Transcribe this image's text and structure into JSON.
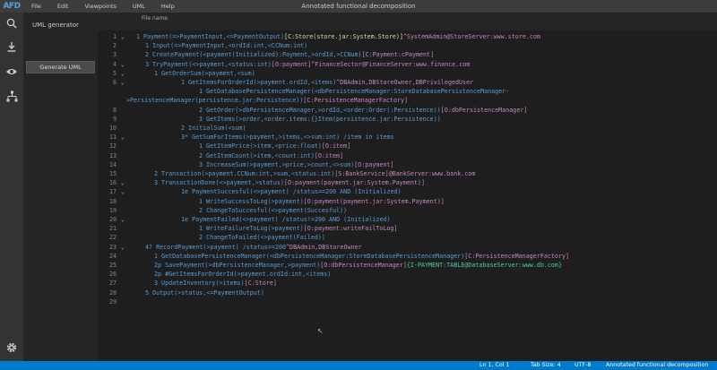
{
  "app": {
    "logo": "AFD",
    "window_title": "Annotated functional decomposition"
  },
  "menu": [
    "File",
    "Edit",
    "Viewpoints",
    "UML",
    "Help"
  ],
  "sidebar": {
    "title": "UML generator",
    "generate_button": "Generate UML"
  },
  "editor": {
    "tab_label": "File name"
  },
  "icons": [
    "search-icon",
    "download-icon",
    "eye-icon",
    "hierarchy-icon",
    "gear-icon"
  ],
  "code": [
    {
      "n": "1",
      "fold": "v",
      "ind": 0,
      "segs": [
        [
          "1 Payment(=>PaymentInput,<=PaymentOutput)",
          "k"
        ],
        [
          "[C:Store(store.jar:System.Store)]",
          "y"
        ],
        [
          "^SystemAdmin@StoreServer:www.store.com",
          "n"
        ]
      ]
    },
    {
      "n": "2",
      "fold": "",
      "ind": 1,
      "segs": [
        [
          "1 Input(=>PaymentInput,<ordId:int,<CCNum:int)",
          "k"
        ]
      ]
    },
    {
      "n": "3",
      "fold": "",
      "ind": 1,
      "segs": [
        [
          "2 CreatePayment(<payment(Initialized):Payment,>ordId,>CCNum)",
          "k"
        ],
        [
          "[C:Payment:cPayment]",
          "n"
        ]
      ]
    },
    {
      "n": "4",
      "fold": "v",
      "ind": 1,
      "segs": [
        [
          "3 TryPayment(<>payment,<status:int)",
          "k"
        ],
        [
          "[O:payment]",
          "n"
        ],
        [
          "^FinanceSector@FinanceServer:www.finance.com",
          "n"
        ]
      ]
    },
    {
      "n": "5",
      "fold": "v",
      "ind": 2,
      "segs": [
        [
          "1 GetOrderSum(>payment,<sum)",
          "k"
        ]
      ]
    },
    {
      "n": "6",
      "fold": "v",
      "ind": 3,
      "segs": [
        [
          "1 GetItemsForOrderId(>payment.ordId,<items)",
          "k"
        ],
        [
          "^DBAdmin,DBStoreOwner,DBPrivilegedUser",
          "n"
        ]
      ]
    },
    {
      "n": "",
      "fold": "",
      "ind": 4,
      "segs": [
        [
          "1 GetDatabasePersistenceManager(<dbPersistenceManager:StoreDatabasePersistenceManager-",
          "k"
        ]
      ]
    },
    {
      "n": "",
      "fold": "",
      "ind": -1,
      "segs": [
        [
          ">PersistenceManager(persistence.jar:Persistence))",
          "k"
        ],
        [
          "[C:PersistenceManagerFactory]",
          "n"
        ]
      ]
    },
    {
      "n": "8",
      "fold": "",
      "ind": 4,
      "segs": [
        [
          "2 GetOrder(>dbPersistenceManager,>ordId,<order:Order(:Persistence))",
          "k"
        ],
        [
          "[O:dbPersistenceManager]",
          "n"
        ]
      ]
    },
    {
      "n": "9",
      "fold": "",
      "ind": 4,
      "segs": [
        [
          "3 GetItems(>order,<order.items:{}Item(persistence.jar:Persistence))",
          "k"
        ]
      ]
    },
    {
      "n": "10",
      "fold": "",
      "ind": 3,
      "segs": [
        [
          "2 InitialSum(<sum)",
          "k"
        ]
      ]
    },
    {
      "n": "11",
      "fold": "v",
      "ind": 3,
      "segs": [
        [
          "3* GetSumForItems(>payment,>items,<>sum:int) /item in items",
          "k"
        ]
      ]
    },
    {
      "n": "12",
      "fold": "",
      "ind": 4,
      "segs": [
        [
          "1 GetItemPrice(>item,<price:float)",
          "k"
        ],
        [
          "[O:item]",
          "n"
        ]
      ]
    },
    {
      "n": "13",
      "fold": "",
      "ind": 4,
      "segs": [
        [
          "2 GetItemCount(>item,<count:int)",
          "k"
        ],
        [
          "[O:item]",
          "n"
        ]
      ]
    },
    {
      "n": "14",
      "fold": "",
      "ind": 4,
      "segs": [
        [
          "3 IncreaseSum(>payment,>price,>count,<>sum)",
          "k"
        ],
        [
          "[O:payment]",
          "n"
        ]
      ]
    },
    {
      "n": "15",
      "fold": "",
      "ind": 2,
      "segs": [
        [
          "2 Transaction(>payment.CCNum:int,>sum,<status:int)",
          "k"
        ],
        [
          "[S:BankService]",
          "n"
        ],
        [
          "@BankServer:www.bank.com",
          "n"
        ]
      ]
    },
    {
      "n": "16",
      "fold": "v",
      "ind": 2,
      "segs": [
        [
          "3 TransactionDone(<>payment,>status)",
          "k"
        ],
        [
          "[O:payment(payment.jar:System.Payment)]",
          "n"
        ]
      ]
    },
    {
      "n": "17",
      "fold": "v",
      "ind": 3,
      "segs": [
        [
          "1e PaymentSuccesful(<>payment) /status==200 AND (Initialized)",
          "k"
        ]
      ]
    },
    {
      "n": "18",
      "fold": "",
      "ind": 4,
      "segs": [
        [
          "1 WriteSuccessToLog(>payment)",
          "k"
        ],
        [
          "[O:payment(payment.jar:System.Payment)]",
          "n"
        ]
      ]
    },
    {
      "n": "19",
      "fold": "",
      "ind": 4,
      "segs": [
        [
          "2 ChangeToSuccesful(<>payment(Succesful))",
          "k"
        ]
      ]
    },
    {
      "n": "20",
      "fold": "v",
      "ind": 3,
      "segs": [
        [
          "1e PaymentFailed(<>payment) /status!=200 AND (Initialized)",
          "k"
        ]
      ]
    },
    {
      "n": "21",
      "fold": "",
      "ind": 4,
      "segs": [
        [
          "1 WriteFailureToLog(>payment)",
          "k"
        ],
        [
          "[O:payment:writeFailToLog]",
          "n"
        ]
      ]
    },
    {
      "n": "22",
      "fold": "",
      "ind": 4,
      "segs": [
        [
          "2 ChangeToFailed(<>payment(Failed))",
          "k"
        ]
      ]
    },
    {
      "n": "23",
      "fold": "v",
      "ind": 1,
      "segs": [
        [
          "4? RecordPayment(>payment) /status==200",
          "k"
        ],
        [
          "^DBAdmin,DBStoreOwner",
          "n"
        ]
      ]
    },
    {
      "n": "24",
      "fold": "",
      "ind": 2,
      "segs": [
        [
          "1 GetDatabasePersistenceManager(<dbPersistenceManager:StoreDatabasePersistenceManager)",
          "k"
        ],
        [
          "[C:PersistenceManagerFactory]",
          "n"
        ]
      ]
    },
    {
      "n": "25",
      "fold": "",
      "ind": 2,
      "segs": [
        [
          "2p SavePayment(>dbPersistenceManager,>payment)",
          "k"
        ],
        [
          "[O:dbPersistenceManager]",
          "n"
        ],
        [
          "{I-PAYMENT:TABLE@DatabaseServer:www.db.com}",
          "t"
        ]
      ]
    },
    {
      "n": "26",
      "fold": "",
      "ind": 2,
      "segs": [
        [
          "2p #GetItemsForOrderId(>payment.ordId:int,<items)",
          "k"
        ]
      ]
    },
    {
      "n": "27",
      "fold": "",
      "ind": 2,
      "segs": [
        [
          "3 UpdateInventory(>items)",
          "k"
        ],
        [
          "[C:Store]",
          "n"
        ]
      ]
    },
    {
      "n": "28",
      "fold": "",
      "ind": 1,
      "segs": [
        [
          "5 Output(>status,<=PaymentOutput)",
          "k"
        ]
      ]
    },
    {
      "n": "29",
      "fold": "",
      "ind": 0,
      "segs": []
    }
  ],
  "status": {
    "position": "Ln 1,  Col 1",
    "tab_size": "Tab Size: 4",
    "encoding": "UTF-8",
    "language": "Annotated functional decomposition"
  }
}
